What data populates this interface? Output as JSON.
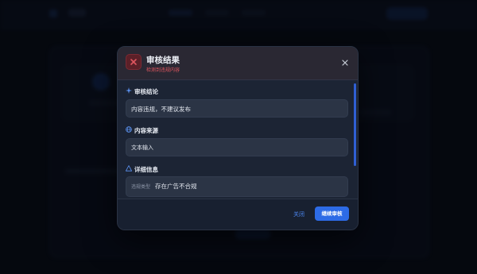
{
  "dialog": {
    "title": "审核结果",
    "subtitle": "检测到违规内容",
    "close_icon": "close-icon",
    "status_icon": "error-x-icon",
    "accent_color": "#e0565f"
  },
  "sections": {
    "conclusion": {
      "title": "审核结论",
      "icon": "sparkle-icon",
      "value": "内容违规，不建议发布"
    },
    "source": {
      "title": "内容来源",
      "icon": "globe-icon",
      "value": "文本输入"
    },
    "details": {
      "title": "详细信息",
      "icon": "warning-triangle-icon",
      "label": "违规类型",
      "value": "存在广告不合规"
    }
  },
  "footer": {
    "close_label": "关闭",
    "continue_label": "继续审核",
    "primary_color": "#2d6be6"
  }
}
